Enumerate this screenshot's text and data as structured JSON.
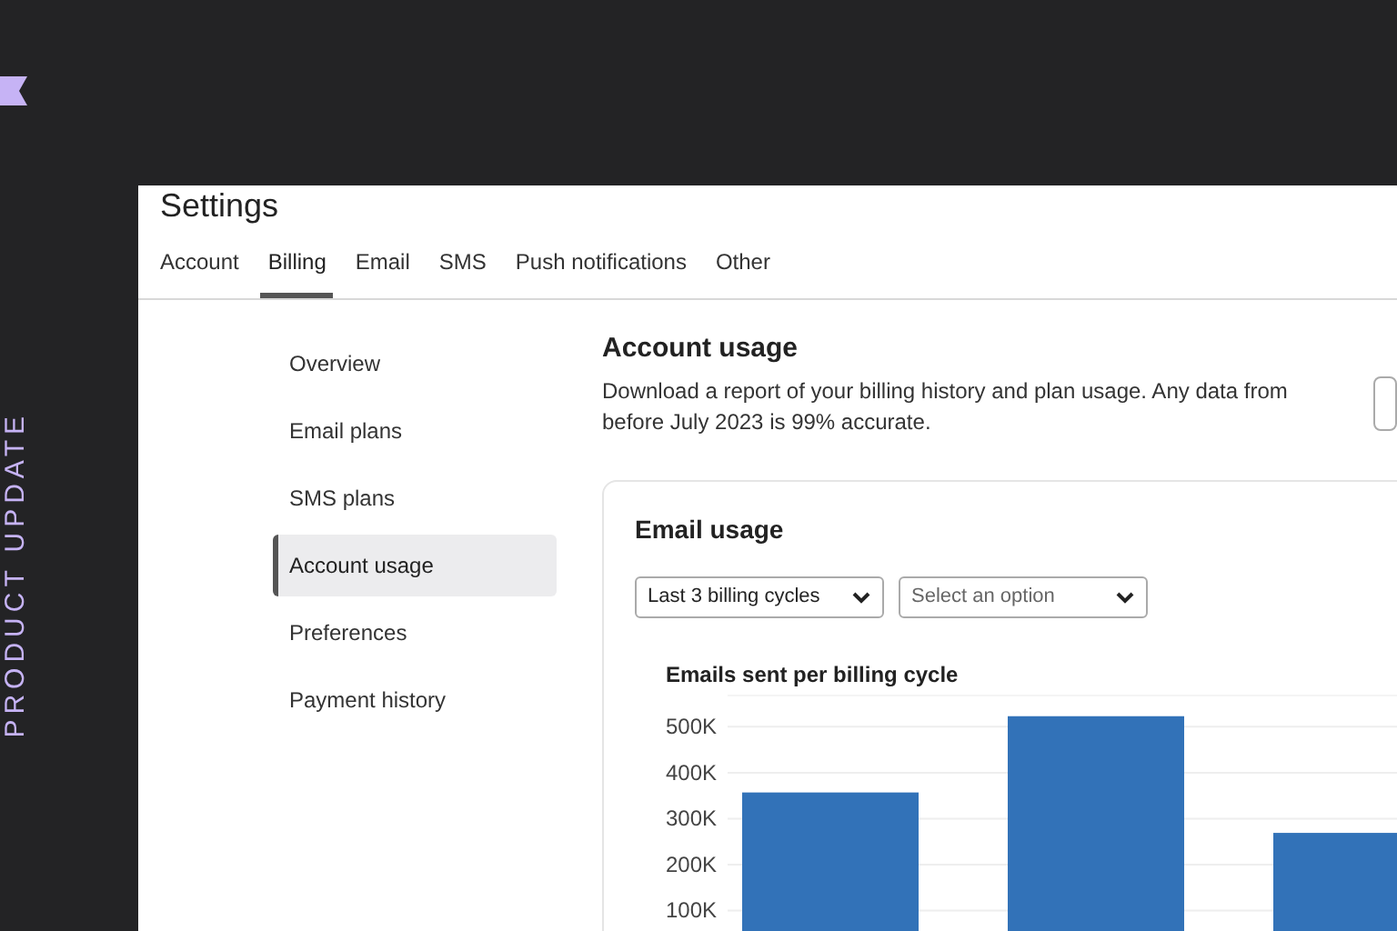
{
  "banner": {
    "label": "PRODUCT UPDATE"
  },
  "window": {
    "title": "Settings"
  },
  "tabs": [
    {
      "label": "Account",
      "selected": false
    },
    {
      "label": "Billing",
      "selected": true
    },
    {
      "label": "Email",
      "selected": false
    },
    {
      "label": "SMS",
      "selected": false
    },
    {
      "label": "Push notifications",
      "selected": false
    },
    {
      "label": "Other",
      "selected": false
    }
  ],
  "sidebar": {
    "items": [
      {
        "label": "Overview",
        "selected": false
      },
      {
        "label": "Email plans",
        "selected": false
      },
      {
        "label": "SMS plans",
        "selected": false
      },
      {
        "label": "Account usage",
        "selected": true
      },
      {
        "label": "Preferences",
        "selected": false
      },
      {
        "label": "Payment history",
        "selected": false
      }
    ]
  },
  "section": {
    "title": "Account usage",
    "description": "Download a report of your billing history and plan usage. Any data from before July 2023 is 99% accurate."
  },
  "card": {
    "title": "Email usage",
    "filters": [
      {
        "value": "Last 3 billing cycles"
      },
      {
        "placeholder": "Select an option"
      }
    ],
    "chart_data": {
      "type": "bar",
      "title": "Emails sent per billing cycle",
      "series": [
        {
          "color": "#3272b8",
          "values": [
            357000,
            523000,
            269000
          ]
        }
      ],
      "ylim": [
        0,
        570000
      ],
      "grid": true,
      "yticks": [
        {
          "value": 100000,
          "label": "100K"
        },
        {
          "value": 200000,
          "label": "200K"
        },
        {
          "value": 300000,
          "label": "300K"
        },
        {
          "value": 400000,
          "label": "400K"
        },
        {
          "value": 500000,
          "label": "500K"
        }
      ]
    }
  }
}
